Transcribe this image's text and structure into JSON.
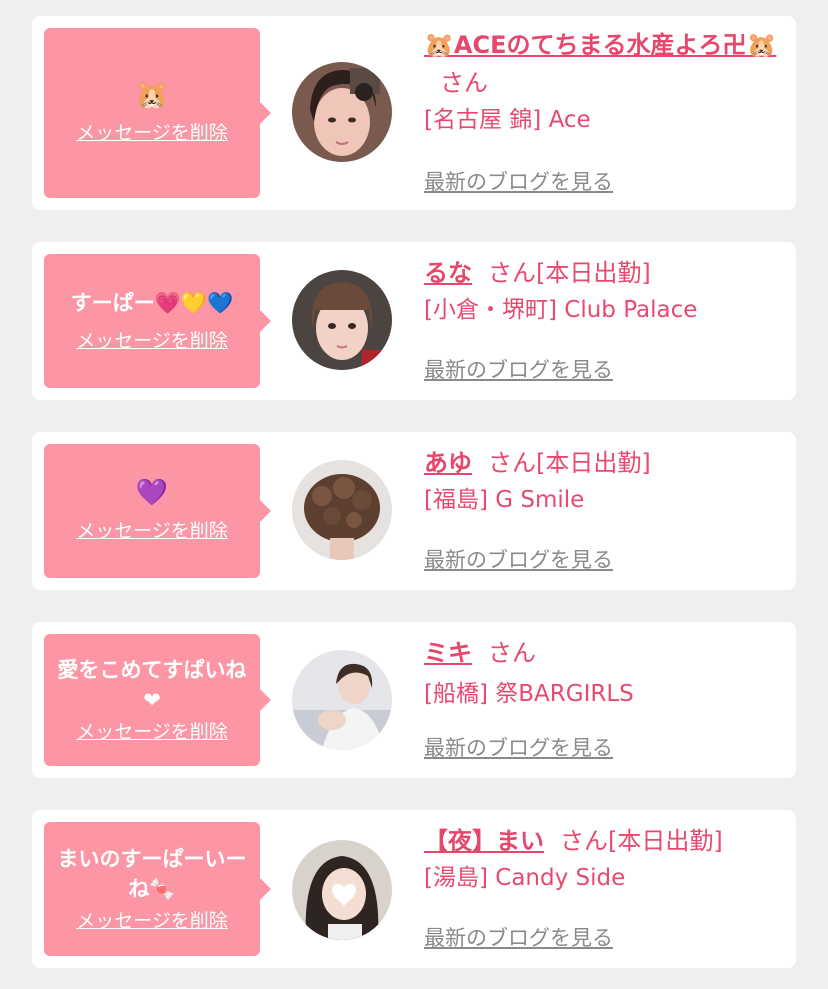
{
  "entries": [
    {
      "message": "🐹",
      "delete_label": "メッセージを削除",
      "name": "🐹ACEのてちまる水産よろ卍🐹",
      "honorific": "さん",
      "status": "",
      "shop": "[名古屋 錦] Ace",
      "blog_label": "最新のブログを見る"
    },
    {
      "message": "すーぱー💗💛💙",
      "delete_label": "メッセージを削除",
      "name": "るな",
      "honorific": "さん",
      "status": "[本日出勤]",
      "shop": "[小倉・堺町] Club Palace",
      "blog_label": "最新のブログを見る"
    },
    {
      "message": "💜",
      "delete_label": "メッセージを削除",
      "name": "あゆ",
      "honorific": "さん",
      "status": "[本日出勤]",
      "shop": "[福島] G Smile",
      "blog_label": "最新のブログを見る"
    },
    {
      "message": "愛をこめてすぱいね❤",
      "delete_label": "メッセージを削除",
      "name": "ミキ",
      "honorific": "さん",
      "status": "",
      "shop": "[船橋] 祭BARGIRLS",
      "blog_label": "最新のブログを見る"
    },
    {
      "message": "まいのすーぱーいーね🍬",
      "delete_label": "メッセージを削除",
      "name": "【夜】まい",
      "honorific": "さん",
      "status": "[本日出勤]",
      "shop": "[湯島] Candy Side",
      "blog_label": "最新のブログを見る"
    }
  ]
}
